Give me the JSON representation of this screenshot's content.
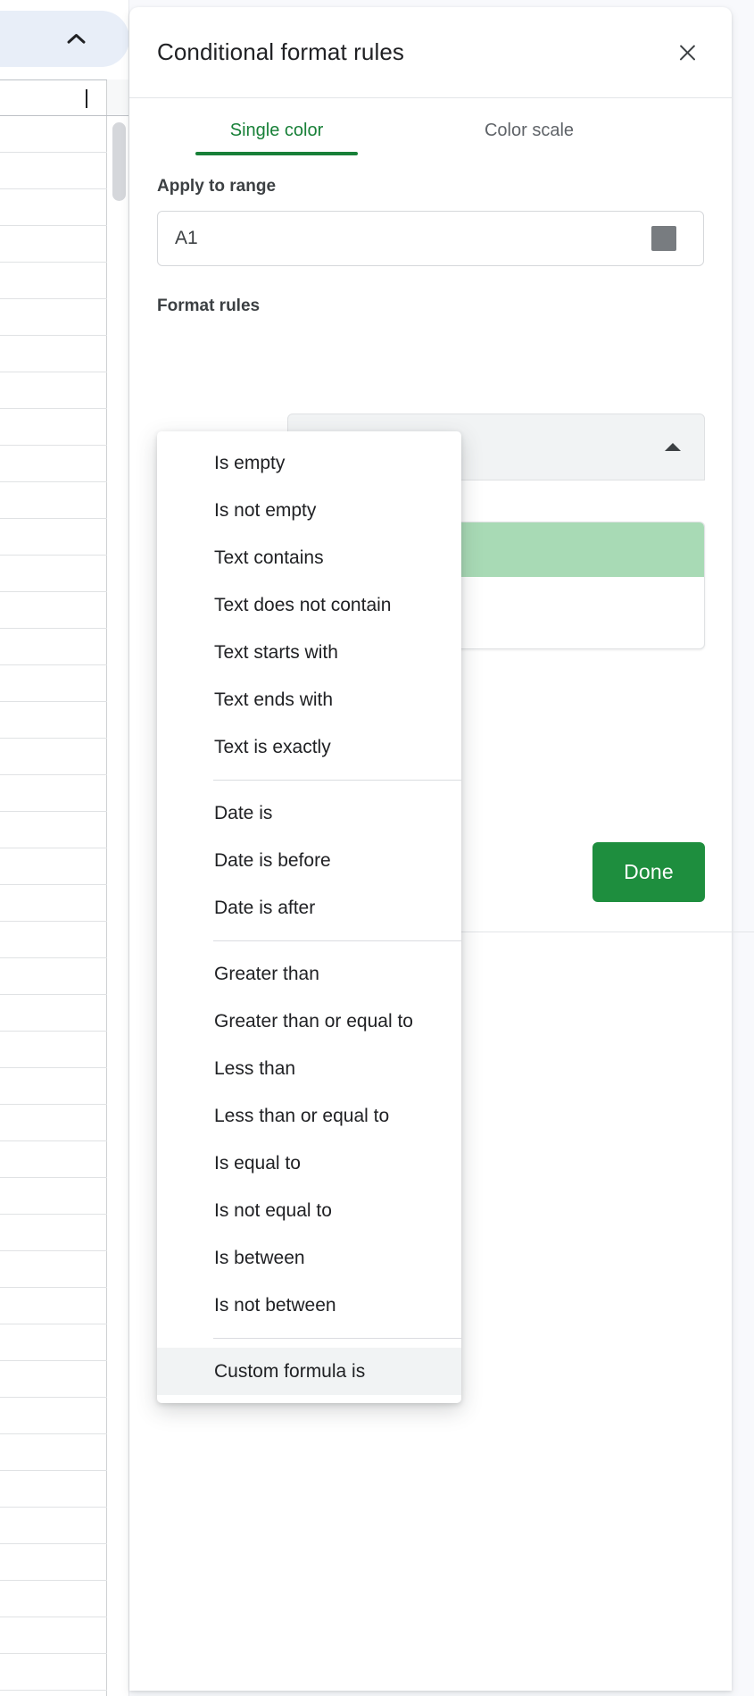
{
  "spreadsheet": {
    "collapse_icon": "chevron-up-icon",
    "active_cell_cursor": true,
    "row_count": 44
  },
  "panel": {
    "title": "Conditional format rules",
    "close_icon": "close-icon",
    "tabs": [
      {
        "label": "Single color",
        "active": true
      },
      {
        "label": "Color scale",
        "active": false
      }
    ],
    "apply_to_range": {
      "label": "Apply to range",
      "value": "A1",
      "placeholder": "A1",
      "picker_icon": "grid-select-range-icon"
    },
    "format_rules": {
      "label": "Format rules",
      "select_caret_icon": "caret-up-icon",
      "preview_swatch_color": "#a8dab5"
    },
    "done_label": "Done"
  },
  "dropdown": {
    "groups": [
      {
        "items": [
          "Is empty",
          "Is not empty",
          "Text contains",
          "Text does not contain",
          "Text starts with",
          "Text ends with",
          "Text is exactly"
        ]
      },
      {
        "items": [
          "Date is",
          "Date is before",
          "Date is after"
        ]
      },
      {
        "items": [
          "Greater than",
          "Greater than or equal to",
          "Less than",
          "Less than or equal to",
          "Is equal to",
          "Is not equal to",
          "Is between",
          "Is not between"
        ]
      },
      {
        "items": [
          "Custom formula is"
        ],
        "highlighted": "Custom formula is"
      }
    ]
  },
  "colors": {
    "accent_green": "#188038",
    "done_green": "#1e8e3e",
    "swatch_green": "#a8dab5",
    "hover_gray": "#f1f3f4"
  }
}
